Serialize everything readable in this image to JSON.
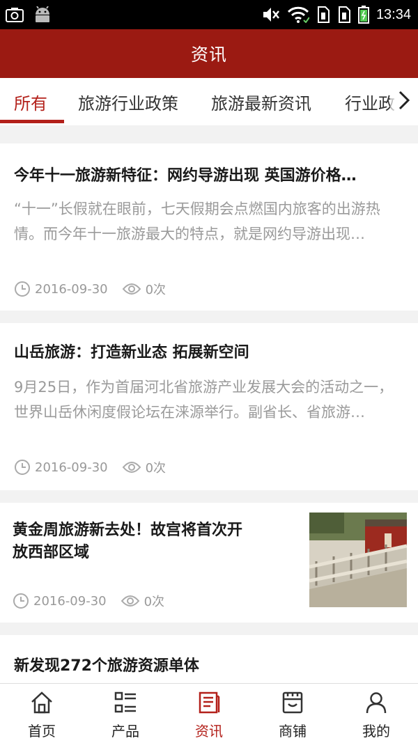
{
  "status_bar": {
    "time": "13:34",
    "icons": [
      "screenshot-icon",
      "android-icon",
      "mute-icon",
      "wifi-icon",
      "sim1-icon",
      "sim2-icon",
      "battery-icon"
    ]
  },
  "header": {
    "title": "资讯"
  },
  "tabs": [
    {
      "label": "所有",
      "active": true
    },
    {
      "label": "旅游行业政策",
      "active": false
    },
    {
      "label": "旅游最新资讯",
      "active": false
    },
    {
      "label": "行业政",
      "active": false
    }
  ],
  "articles": [
    {
      "title": "今年十一旅游新特征：网约导游出现 英国游价格…",
      "summary": "“十一”长假就在眼前，七天假期会点燃国内旅客的出游热情。而今年十一旅游最大的特点，就是网约导游出现…",
      "date": "2016-09-30",
      "views": "0次"
    },
    {
      "title": "山岳旅游：打造新业态 拓展新空间",
      "summary": "9月25日，作为首届河北省旅游产业发展大会的活动之一，世界山岳休闲度假论坛在涞源举行。副省长、省旅游…",
      "date": "2016-09-30",
      "views": "0次"
    },
    {
      "title_line1": "黄金周旅游新去处！故宫将首次开",
      "title_line2": "放西部区域",
      "date": "2016-09-30",
      "views": "0次",
      "has_image": true
    },
    {
      "title": "新发现272个旅游资源单体"
    }
  ],
  "bottom_nav": [
    {
      "label": "首页",
      "icon": "home-icon",
      "active": false
    },
    {
      "label": "产品",
      "icon": "list-icon",
      "active": false
    },
    {
      "label": "资讯",
      "icon": "news-icon",
      "active": true
    },
    {
      "label": "商铺",
      "icon": "shop-icon",
      "active": false
    },
    {
      "label": "我的",
      "icon": "user-icon",
      "active": false
    }
  ],
  "colors": {
    "brand": "#9b1a12",
    "accent": "#b3201a",
    "summary_text": "#9a9a9a"
  }
}
